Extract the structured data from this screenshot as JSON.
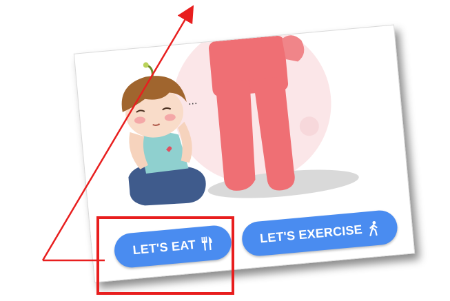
{
  "buttons": {
    "eat_label": "LET'S EAT",
    "exercise_label": "LET'S EXERCISE",
    "eat_icon": "fork-knife-icon",
    "exercise_icon": "walking-person-icon"
  },
  "illustration": {
    "ellipsis_text": "...",
    "subjects": [
      "cartoon-boy-sitting",
      "red-figure-legs"
    ]
  },
  "annotation": {
    "highlight_color": "#e81e1e",
    "highlight_target": "eat-button"
  },
  "colors": {
    "button_blue": "#4a8cf0",
    "button_text": "#ffffff",
    "figure_red": "#ef6f74",
    "figure_pale": "#fbe6e8"
  }
}
